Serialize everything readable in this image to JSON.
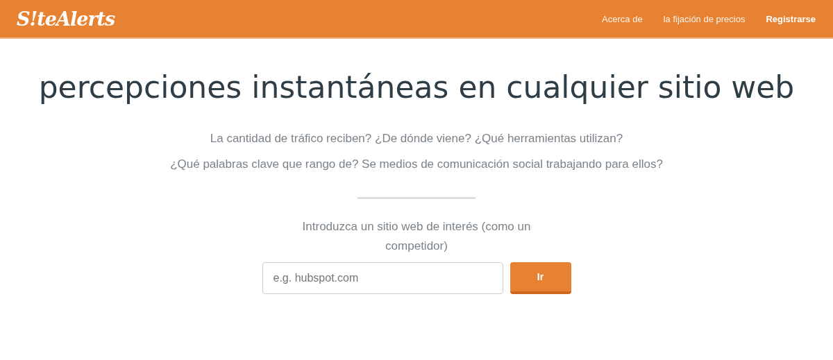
{
  "header": {
    "logo": "S!teAlerts",
    "nav": [
      {
        "label": "Acerca de",
        "kind": "link"
      },
      {
        "label": "la fijación de precios",
        "kind": "link"
      },
      {
        "label": "Registrarse",
        "kind": "cta"
      }
    ]
  },
  "hero": {
    "title": "percepciones instantáneas en cualquier sitio web",
    "questions": [
      "La cantidad de tráfico reciben? ¿De dónde viene? ¿Qué herramientas utilizan?",
      "¿Qué palabras clave que rango de? Se medios de comunicación social trabajando para ellos?"
    ],
    "prompt": "Introduzca un sitio web de interés (como un competidor)",
    "search": {
      "placeholder": "e.g. hubspot.com"
    },
    "button": "Ir"
  }
}
